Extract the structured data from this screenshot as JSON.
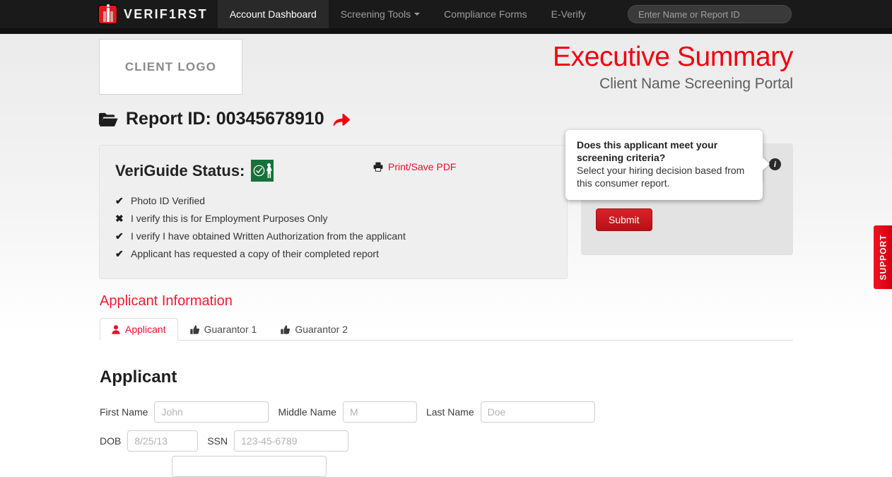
{
  "navbar": {
    "brand": "VERIF1RST",
    "items": [
      {
        "label": "Account Dashboard",
        "active": true,
        "caret": false
      },
      {
        "label": "Screening Tools",
        "active": false,
        "caret": true
      },
      {
        "label": "Compliance Forms",
        "active": false,
        "caret": false
      },
      {
        "label": "E-Verify",
        "active": false,
        "caret": false
      }
    ],
    "search": {
      "value": "",
      "placeholder": "Enter Name or Report ID"
    }
  },
  "header": {
    "client_logo_text": "CLIENT LOGO",
    "title": "Executive Summary",
    "subtitle": "Client Name Screening Portal"
  },
  "report": {
    "label": "Report ID: 00345678910",
    "folder_icon": "folder-open-icon",
    "share_icon": "share-arrow-icon"
  },
  "veriguide": {
    "title": "VeriGuide Status:",
    "badge_icon": "green-verified-person-badge",
    "print_link": "Print/Save PDF",
    "print_icon": "printer-icon",
    "items": [
      {
        "mark": "✔",
        "text": "Photo ID Verified"
      },
      {
        "mark": "✖",
        "text": "I verify this is for Employment Purposes Only"
      },
      {
        "mark": "✔",
        "text": "I verify I have obtained Written Authorization from the applicant"
      },
      {
        "mark": "✔",
        "text": "Applicant has requested a copy of their completed report"
      }
    ]
  },
  "decision": {
    "select_value": "",
    "submit_label": "Submit",
    "info_icon": "info-circle-icon",
    "info_glyph": "i"
  },
  "tooltip": {
    "title": "Does this applicant meet your screening criteria?",
    "body": "Select your hiring decision based from this consumer report."
  },
  "applicant_section": {
    "title": "Applicant Information",
    "tabs": [
      {
        "label": "Applicant",
        "icon": "person-icon",
        "active": true
      },
      {
        "label": "Guarantor 1",
        "icon": "thumbs-up-icon",
        "active": false
      },
      {
        "label": "Guarantor 2",
        "icon": "thumbs-up-icon",
        "active": false
      }
    ],
    "heading": "Applicant",
    "fields": {
      "first_name": {
        "label": "First Name",
        "value": "",
        "placeholder": "John"
      },
      "middle_name": {
        "label": "Middle Name",
        "value": "",
        "placeholder": "M"
      },
      "last_name": {
        "label": "Last Name",
        "value": "",
        "placeholder": "Doe"
      },
      "dob": {
        "label": "DOB",
        "value": "",
        "placeholder": "8/25/13"
      },
      "ssn": {
        "label": "SSN",
        "value": "",
        "placeholder": "123-45-6789"
      }
    }
  },
  "support": {
    "label": "SUPPORT"
  },
  "colors": {
    "brand_red": "#e0191c",
    "title_red": "#f0000f",
    "link_red": "#e8112d",
    "nav_dark": "#1a1a1a",
    "panel_gray": "#efefef",
    "badge_green": "#16713a"
  }
}
